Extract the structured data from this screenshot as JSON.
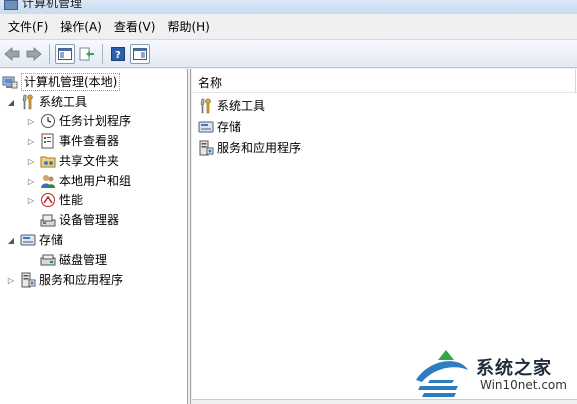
{
  "window": {
    "title": "计算机管理"
  },
  "menu": {
    "items": [
      {
        "label": "文件(F)"
      },
      {
        "label": "操作(A)"
      },
      {
        "label": "查看(V)"
      },
      {
        "label": "帮助(H)"
      }
    ]
  },
  "toolbar": {
    "icons": [
      "back-arrow-icon",
      "forward-arrow-icon",
      "show-hide-tree-icon",
      "export-list-icon",
      "help-icon",
      "properties-pane-icon"
    ]
  },
  "tree": {
    "root": {
      "label": "计算机管理(本地)",
      "icon": "computer-management-icon"
    },
    "system_tools": {
      "label": "系统工具",
      "icon": "tools-icon"
    },
    "task_scheduler": {
      "label": "任务计划程序",
      "icon": "clock-icon"
    },
    "event_viewer": {
      "label": "事件查看器",
      "icon": "event-viewer-icon"
    },
    "shared_folders": {
      "label": "共享文件夹",
      "icon": "shared-folder-icon"
    },
    "local_users": {
      "label": "本地用户和组",
      "icon": "users-icon"
    },
    "performance": {
      "label": "性能",
      "icon": "performance-icon"
    },
    "device_manager": {
      "label": "设备管理器",
      "icon": "device-manager-icon"
    },
    "storage": {
      "label": "存储",
      "icon": "storage-icon"
    },
    "disk_management": {
      "label": "磁盘管理",
      "icon": "disk-icon"
    },
    "services_apps": {
      "label": "服务和应用程序",
      "icon": "services-icon"
    }
  },
  "list": {
    "column_name": "名称",
    "items": [
      {
        "label": "系统工具",
        "icon": "tools-icon"
      },
      {
        "label": "存储",
        "icon": "storage-icon"
      },
      {
        "label": "服务和应用程序",
        "icon": "services-icon"
      }
    ]
  },
  "watermark": {
    "title": "系统之家",
    "url": "Win10net.com"
  },
  "colors": {
    "accent": "#3c7fb1",
    "selection_border": "#7da2ce"
  }
}
